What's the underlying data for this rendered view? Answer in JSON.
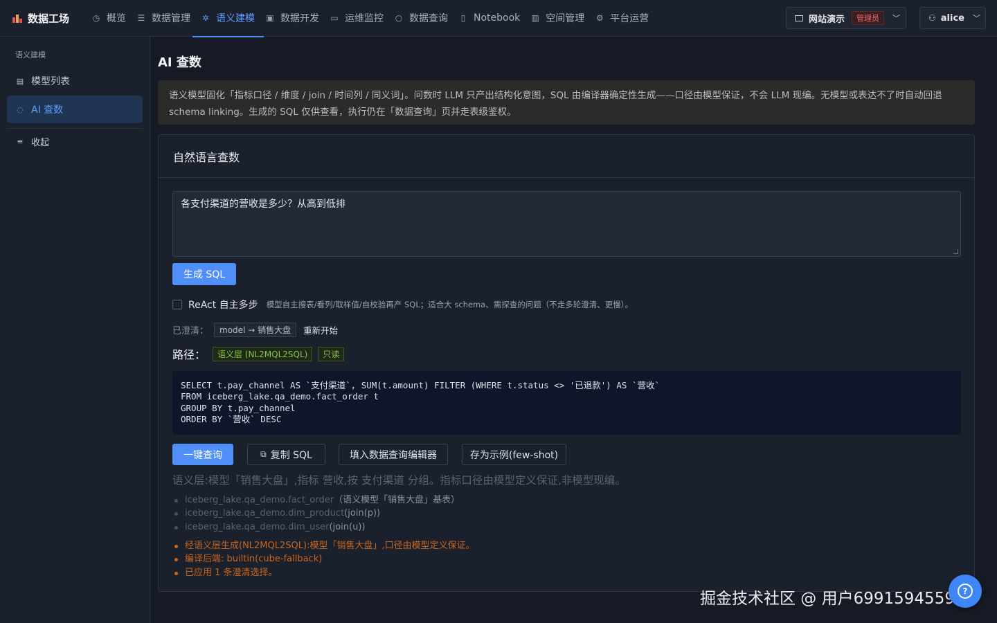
{
  "header": {
    "brand": "数据工场",
    "nav": [
      {
        "label": "概览",
        "icon": "clock-icon"
      },
      {
        "label": "数据管理",
        "icon": "database-icon"
      },
      {
        "label": "语义建模",
        "icon": "sparkle-icon",
        "active": true
      },
      {
        "label": "数据开发",
        "icon": "code-icon"
      },
      {
        "label": "运维监控",
        "icon": "monitor-icon"
      },
      {
        "label": "数据查询",
        "icon": "search-icon"
      },
      {
        "label": "Notebook",
        "icon": "notebook-icon"
      },
      {
        "label": "空间管理",
        "icon": "building-icon"
      },
      {
        "label": "平台运营",
        "icon": "gear-icon"
      }
    ],
    "space": {
      "label": "网站演示",
      "role": "管理员"
    },
    "user": "alice"
  },
  "sidebar": {
    "group": "语义建模",
    "items": [
      {
        "label": "模型列表",
        "icon": "list-icon"
      },
      {
        "label": "AI 查数",
        "icon": "chat-icon",
        "active": true
      }
    ],
    "collapse": "收起"
  },
  "main": {
    "title": "AI 查数",
    "notice": "语义模型固化「指标口径 / 维度 / join / 时间列 / 同义词」。问数时 LLM 只产出结构化意图，SQL 由编译器确定性生成——口径由模型保证，不会 LLM 现编。无模型或表达不了时自动回退 schema linking。生成的 SQL 仅供查看，执行仍在「数据查询」页并走表级鉴权。",
    "card_title": "自然语言查数",
    "query": "各支付渠道的营收是多少？从高到低排",
    "generate_btn": "生成 SQL",
    "react": {
      "label": "ReAct 自主多步",
      "hint": "模型自主搜表/看列/取样值/自校验再产 SQL；适合大 schema、需探查的问题（不走多轮澄清、更慢）。"
    },
    "clarified": {
      "label": "已澄清：",
      "tag": "model → 销售大盘",
      "restart": "重新开始"
    },
    "path": {
      "label": "路径：",
      "tags": [
        "语义层 (NL2MQL2SQL)",
        "只读"
      ]
    },
    "sql": "SELECT t.pay_channel AS `支付渠道`, SUM(t.amount) FILTER (WHERE t.status <> '已退款') AS `营收`\nFROM iceberg_lake.qa_demo.fact_order t\nGROUP BY t.pay_channel\nORDER BY `营收` DESC",
    "actions": {
      "run": "一键查询",
      "copy": "复制 SQL",
      "fill": "填入数据查询编辑器",
      "save": "存为示例(few-shot)"
    },
    "explain": "语义层:模型「销售大盘」,指标 营收,按 支付渠道 分组。指标口径由模型定义保证,非模型现编。",
    "tables": [
      {
        "name": "iceberg_lake.qa_demo.fact_order",
        "note": "（语义模型「销售大盘」基表）"
      },
      {
        "name": "iceberg_lake.qa_demo.dim_product",
        "note": "(join(p))"
      },
      {
        "name": "iceberg_lake.qa_demo.dim_user",
        "note": "(join(u))"
      }
    ],
    "logs": [
      "经语义层生成(NL2MQL2SQL):模型「销售大盘」,口径由模型定义保证。",
      "编译后端: builtin(cube-fallback)",
      "已应用 1 条澄清选择。"
    ]
  },
  "watermark": "掘金技术社区 @ 用户6991594559​57",
  "colors": {
    "accent": "#4f8ff7",
    "warning": "#c8651f",
    "success": "#89c24d",
    "danger": "#f36b6b"
  }
}
